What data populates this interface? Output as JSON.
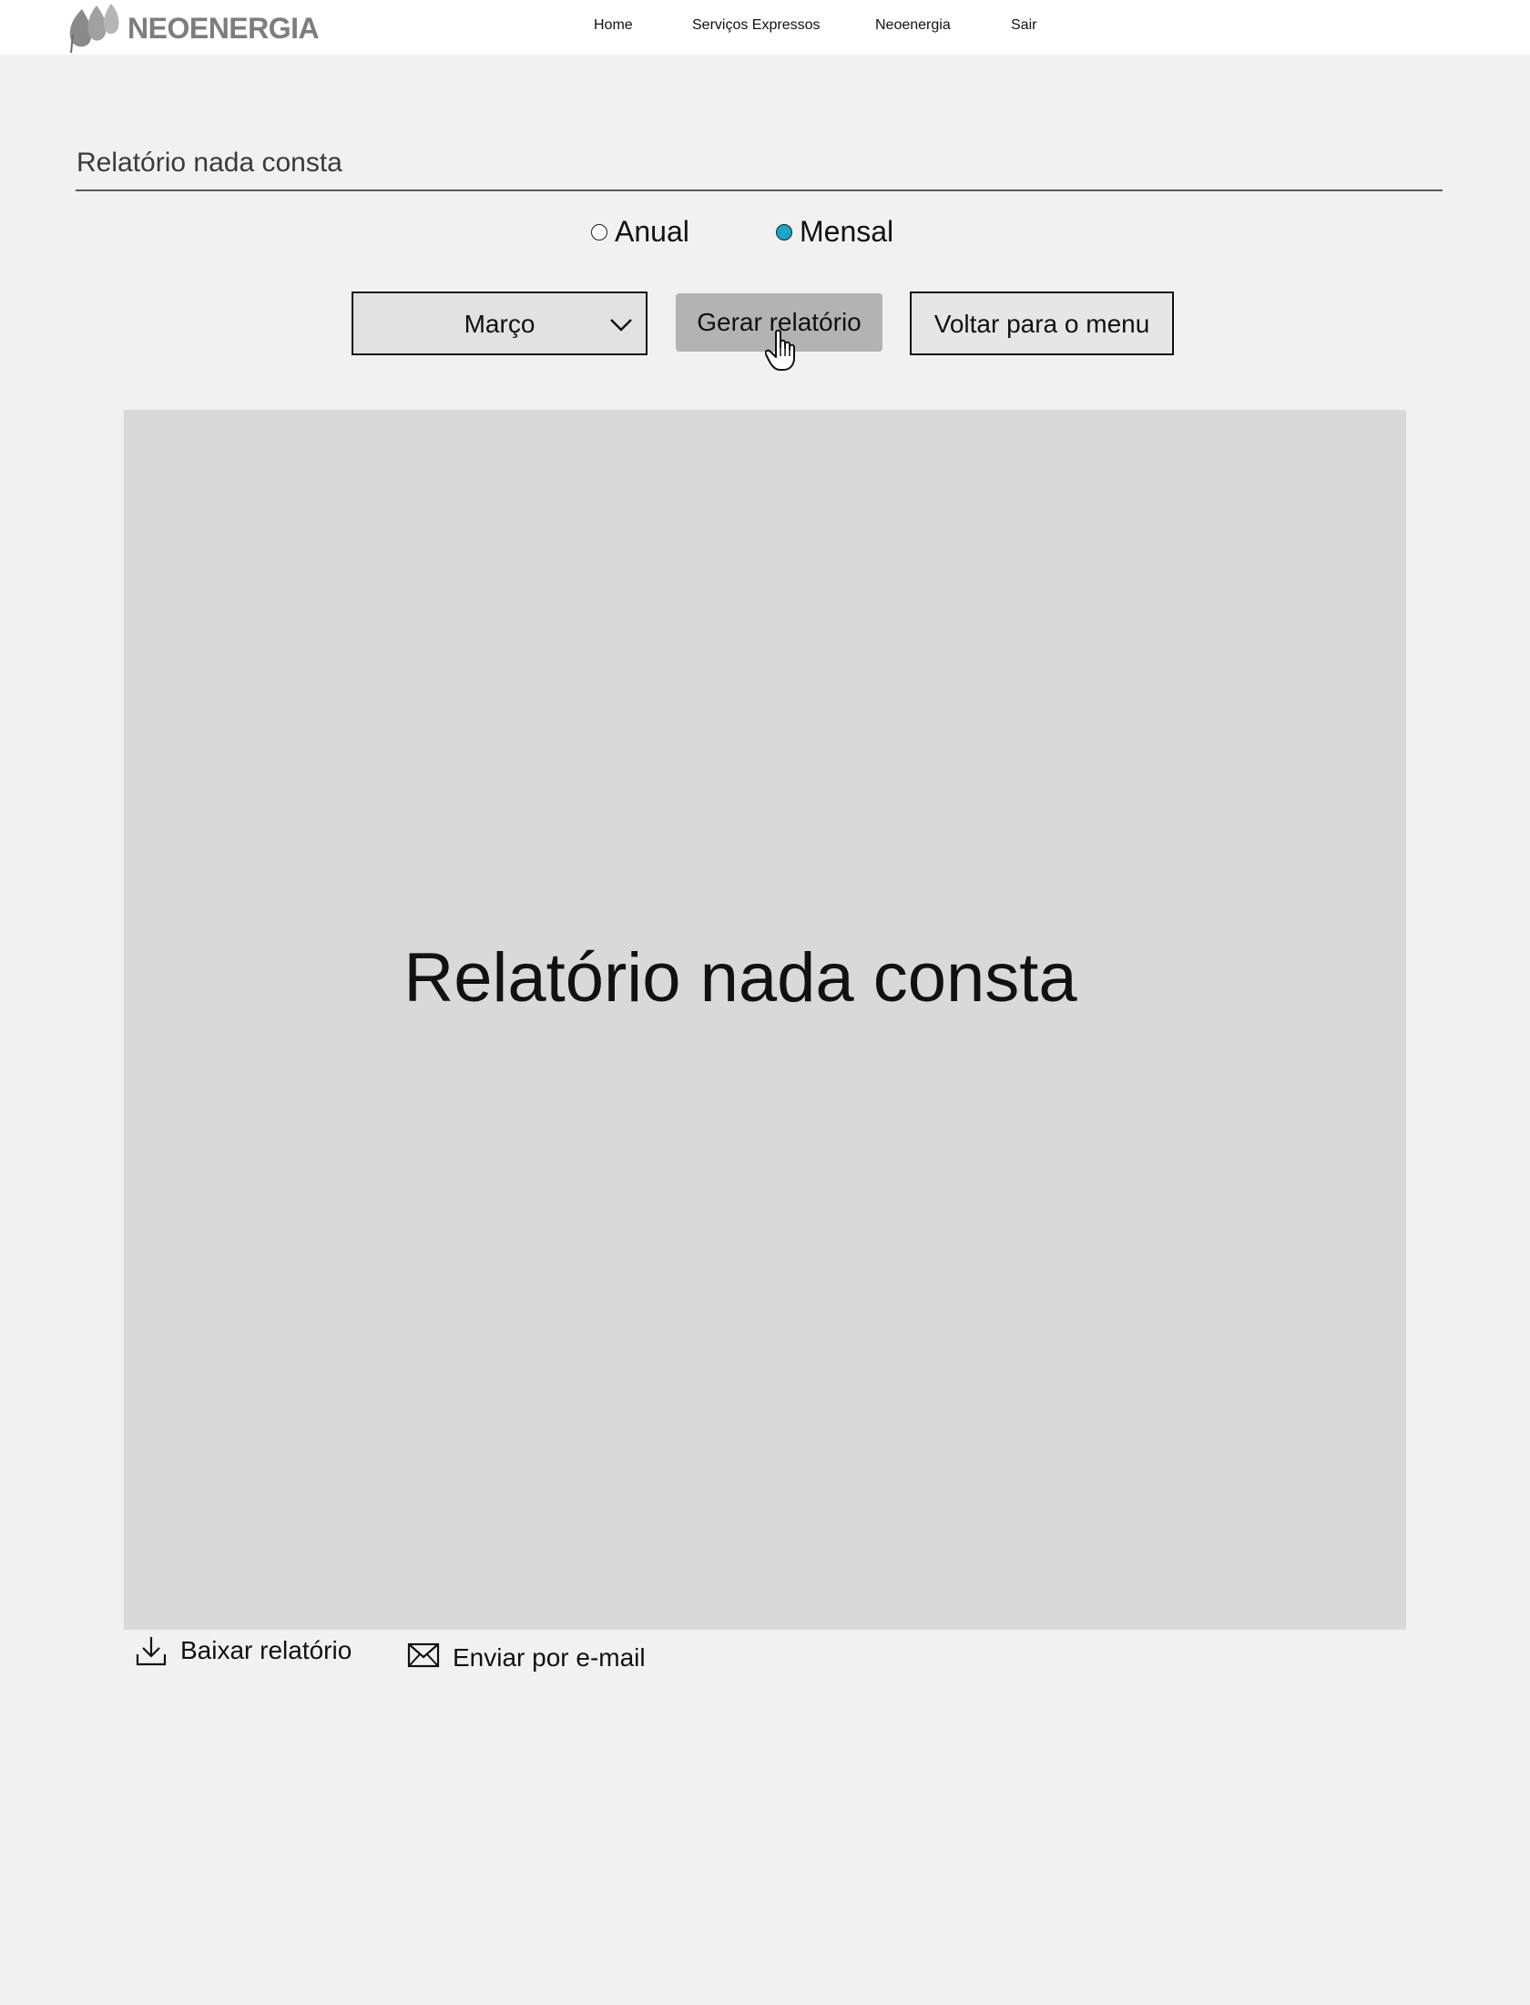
{
  "header": {
    "brand": "NEOENERGIA",
    "nav": [
      {
        "label": "Home"
      },
      {
        "label": "Serviços Expressos"
      },
      {
        "label": "Neoenergia"
      },
      {
        "label": "Sair"
      }
    ]
  },
  "main": {
    "heading": "Relatório nada consta",
    "period": {
      "options": [
        {
          "label": "Anual",
          "selected": false
        },
        {
          "label": "Mensal",
          "selected": true
        }
      ]
    },
    "month_select": {
      "value": "Março"
    },
    "generate_label": "Gerar relatório",
    "back_label": "Voltar para o menu",
    "preview": {
      "title": "Relatório nada consta"
    },
    "actions": {
      "download_label": "Baixar relatório",
      "email_label": "Enviar por e-mail"
    }
  },
  "colors": {
    "radio_selected": "#19a7c7",
    "page_background": "#f1f1f1",
    "preview_background": "#d9d9d9",
    "generate_button": "#b3b3b3"
  },
  "icons": {
    "logo": "leaf-logo-icon",
    "dropdown": "chevron-down-icon",
    "cursor": "hand-pointer-icon",
    "download": "download-icon",
    "email": "envelope-icon"
  }
}
